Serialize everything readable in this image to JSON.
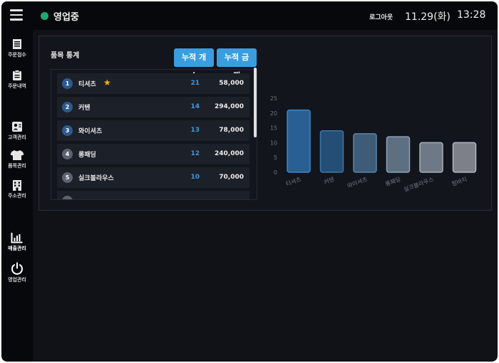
{
  "header": {
    "status": "영업중",
    "logout": "로그아웃",
    "date": "11.29(화)",
    "time": "13:28",
    "status_color": "#1fa870"
  },
  "sidebar": {
    "items": [
      {
        "label": "주문접수",
        "icon": "order-receipt-icon"
      },
      {
        "label": "주문내역",
        "icon": "clipboard-icon"
      },
      {
        "label": "고객관리",
        "icon": "customer-card-icon"
      },
      {
        "label": "품목관리",
        "icon": "tshirt-icon"
      },
      {
        "label": "주소관리",
        "icon": "building-icon"
      },
      {
        "label": "매출관리",
        "icon": "bar-chart-icon"
      },
      {
        "label": "영업관리",
        "icon": "power-icon"
      }
    ]
  },
  "panel": {
    "title": "품목 통계",
    "tab_count": "누적 개수",
    "tab_amount": "누적 금액",
    "accent": "#3a9de0"
  },
  "items": [
    {
      "rank": "1",
      "name": "티셔츠",
      "count": "21",
      "amount": "58,000",
      "starred": true
    },
    {
      "rank": "2",
      "name": "커텐",
      "count": "14",
      "amount": "294,000"
    },
    {
      "rank": "3",
      "name": "와이셔츠",
      "count": "13",
      "amount": "78,000"
    },
    {
      "rank": "4",
      "name": "롱패딩",
      "count": "12",
      "amount": "240,000"
    },
    {
      "rank": "5",
      "name": "실크블라우스",
      "count": "10",
      "amount": "70,000"
    }
  ],
  "chart_data": {
    "type": "bar",
    "categories": [
      "티셔츠",
      "커텐",
      "와이셔츠",
      "롱패딩",
      "실크블라우스",
      "청바지"
    ],
    "values": [
      21,
      14,
      13,
      12,
      10,
      10
    ],
    "ylim": [
      0,
      25
    ],
    "yticks": [
      "0",
      "5",
      "10",
      "15",
      "20",
      "25"
    ],
    "xlabel": "",
    "ylabel": "",
    "colors": [
      "#2a5f92",
      "#244e73",
      "#3e5b78",
      "#5f6f82",
      "#6f7885",
      "#7d8089"
    ],
    "border_colors": [
      "#3d86c8",
      "#3a78ad",
      "#5b85ad",
      "#8aa3bd",
      "#a8b2be",
      "#b4b8c0"
    ]
  }
}
